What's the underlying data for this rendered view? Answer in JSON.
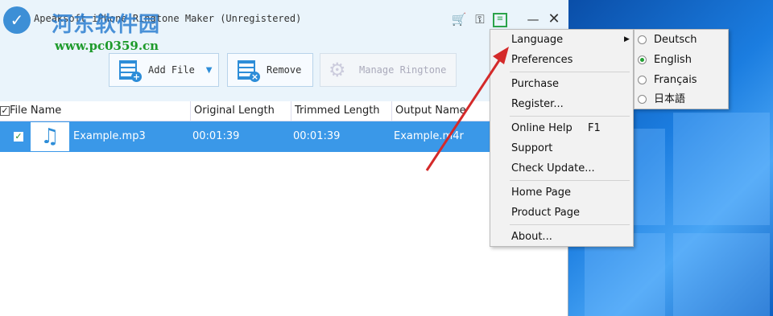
{
  "window": {
    "title": "Apeaksoft iPhone Ringtone Maker (Unregistered)"
  },
  "watermark": {
    "line1": "河东软件园",
    "line2": "www.pc0359.cn"
  },
  "titlebar_icons": [
    "cart-icon",
    "key-icon",
    "menu-icon",
    "minimize-icon",
    "close-icon"
  ],
  "toolbar": {
    "add_file": "Add File",
    "remove": "Remove",
    "manage": "Manage Ringtone"
  },
  "table": {
    "headers": [
      "File Name",
      "Original Length",
      "Trimmed Length",
      "Output Name"
    ],
    "rows": [
      {
        "file": "Example.mp3",
        "original": "00:01:39",
        "trimmed": "00:01:39",
        "output": "Example.m4r"
      }
    ]
  },
  "menu": {
    "language": "Language",
    "preferences": "Preferences",
    "purchase": "Purchase",
    "register": "Register...",
    "online_help": "Online Help",
    "online_help_key": "F1",
    "support": "Support",
    "check_update": "Check Update...",
    "home_page": "Home Page",
    "product_page": "Product Page",
    "about": "About..."
  },
  "language_submenu": {
    "options": [
      "Deutsch",
      "English",
      "Français",
      "日本語"
    ],
    "selected": "English"
  },
  "colors": {
    "accent": "#3a98e8",
    "selected_radio": "#22a033",
    "arrow": "#d42a2a"
  }
}
